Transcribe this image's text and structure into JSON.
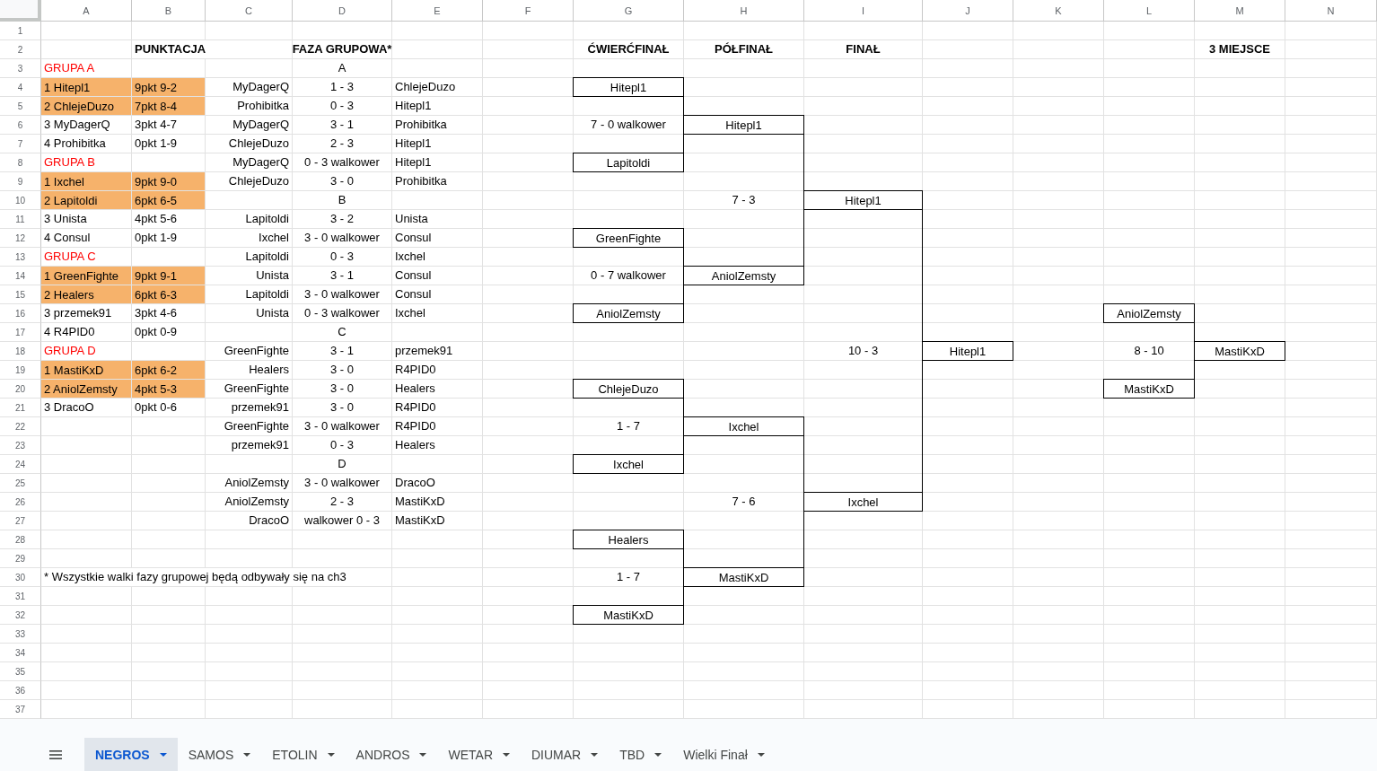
{
  "sheet": {
    "column_headers": [
      "A",
      "B",
      "C",
      "D",
      "E",
      "F",
      "G",
      "H",
      "I",
      "J",
      "K",
      "L",
      "M",
      "N"
    ],
    "rows": [
      {
        "number": "1"
      },
      {
        "number": "2",
        "cells": {
          "b": {
            "kind": "heading",
            "text": "PUNKTACJA"
          },
          "d": {
            "kind": "heading",
            "text": "FAZA GRUPOWA*"
          },
          "g": {
            "kind": "heading",
            "text": "ĆWIERĆFINAŁ"
          },
          "h": {
            "kind": "heading",
            "text": "PÓŁFINAŁ"
          },
          "i": {
            "kind": "heading",
            "text": "FINAŁ"
          },
          "m": {
            "kind": "heading",
            "text": "3 MIEJSCE"
          }
        }
      },
      {
        "number": "3",
        "cells": {
          "a": {
            "kind": "group",
            "text": "GRUPA A"
          },
          "d": {
            "kind": "text",
            "text": "A"
          }
        }
      },
      {
        "number": "4",
        "cells": {
          "a": {
            "kind": "qualified",
            "text": "1 Hitepl1"
          },
          "b": {
            "kind": "qualified",
            "text": "9pkt 9-2"
          },
          "c": {
            "kind": "text",
            "text": "MyDagerQ"
          },
          "d": {
            "kind": "text",
            "text": "1 - 3"
          },
          "e": {
            "kind": "text",
            "text": "ChlejeDuzo"
          },
          "g": {
            "kind": "box",
            "text": "Hitepl1"
          }
        }
      },
      {
        "number": "5",
        "cells": {
          "a": {
            "kind": "qualified",
            "text": "2 ChlejeDuzo"
          },
          "b": {
            "kind": "qualified",
            "text": "7pkt 8-4"
          },
          "c": {
            "kind": "text",
            "text": "Prohibitka"
          },
          "d": {
            "kind": "text",
            "text": "0 - 3"
          },
          "e": {
            "kind": "text",
            "text": "Hitepl1"
          },
          "g": {
            "kind": "line"
          }
        }
      },
      {
        "number": "6",
        "cells": {
          "a": {
            "kind": "text",
            "text": "3 MyDagerQ"
          },
          "b": {
            "kind": "text",
            "text": "3pkt 4-7"
          },
          "c": {
            "kind": "text",
            "text": "MyDagerQ"
          },
          "d": {
            "kind": "text",
            "text": "3 - 1"
          },
          "e": {
            "kind": "text",
            "text": "Prohibitka"
          },
          "g": {
            "kind": "line",
            "text": "7 - 0 walkower"
          },
          "h": {
            "kind": "box",
            "text": "Hitepl1"
          }
        }
      },
      {
        "number": "7",
        "cells": {
          "a": {
            "kind": "text",
            "text": "4 Prohibitka"
          },
          "b": {
            "kind": "text",
            "text": "0pkt 1-9"
          },
          "c": {
            "kind": "text",
            "text": "ChlejeDuzo"
          },
          "d": {
            "kind": "text",
            "text": "2 - 3"
          },
          "e": {
            "kind": "text",
            "text": "Hitepl1"
          },
          "g": {
            "kind": "line"
          },
          "h": {
            "kind": "line"
          }
        }
      },
      {
        "number": "8",
        "cells": {
          "a": {
            "kind": "group",
            "text": "GRUPA B"
          },
          "c": {
            "kind": "text",
            "text": "MyDagerQ"
          },
          "d": {
            "kind": "text",
            "text": "0 - 3 walkower"
          },
          "e": {
            "kind": "text",
            "text": "Hitepl1"
          },
          "g": {
            "kind": "box",
            "text": "Lapitoldi"
          },
          "h": {
            "kind": "line"
          }
        }
      },
      {
        "number": "9",
        "cells": {
          "a": {
            "kind": "qualified",
            "text": "1 Ixchel"
          },
          "b": {
            "kind": "qualified",
            "text": "9pkt 9-0"
          },
          "c": {
            "kind": "text",
            "text": "ChlejeDuzo"
          },
          "d": {
            "kind": "text",
            "text": "3 - 0"
          },
          "e": {
            "kind": "text",
            "text": "Prohibitka"
          },
          "h": {
            "kind": "line"
          }
        }
      },
      {
        "number": "10",
        "cells": {
          "a": {
            "kind": "qualified",
            "text": "2 Lapitoldi"
          },
          "b": {
            "kind": "qualified",
            "text": "6pkt 6-5"
          },
          "d": {
            "kind": "text",
            "text": "B"
          },
          "h": {
            "kind": "line",
            "text": "7 - 3"
          },
          "i": {
            "kind": "box",
            "text": "Hitepl1"
          }
        }
      },
      {
        "number": "11",
        "cells": {
          "a": {
            "kind": "text",
            "text": "3 Unista"
          },
          "b": {
            "kind": "text",
            "text": "4pkt 5-6"
          },
          "c": {
            "kind": "text",
            "text": "Lapitoldi"
          },
          "d": {
            "kind": "text",
            "text": "3 - 2"
          },
          "e": {
            "kind": "text",
            "text": "Unista"
          },
          "h": {
            "kind": "line"
          },
          "i": {
            "kind": "line"
          }
        }
      },
      {
        "number": "12",
        "cells": {
          "a": {
            "kind": "text",
            "text": "4 Consul"
          },
          "b": {
            "kind": "text",
            "text": "0pkt 1-9"
          },
          "c": {
            "kind": "text",
            "text": "Ixchel"
          },
          "d": {
            "kind": "text",
            "text": "3 - 0 walkower"
          },
          "e": {
            "kind": "text",
            "text": "Consul"
          },
          "g": {
            "kind": "box",
            "text": "GreenFighte"
          },
          "h": {
            "kind": "line"
          },
          "i": {
            "kind": "line"
          }
        }
      },
      {
        "number": "13",
        "cells": {
          "a": {
            "kind": "group",
            "text": "GRUPA C"
          },
          "c": {
            "kind": "text",
            "text": "Lapitoldi"
          },
          "d": {
            "kind": "text",
            "text": "0 - 3"
          },
          "e": {
            "kind": "text",
            "text": "Ixchel"
          },
          "g": {
            "kind": "line"
          },
          "h": {
            "kind": "line"
          },
          "i": {
            "kind": "line"
          }
        }
      },
      {
        "number": "14",
        "cells": {
          "a": {
            "kind": "qualified",
            "text": "1 GreenFighte"
          },
          "b": {
            "kind": "qualified",
            "text": "9pkt 9-1"
          },
          "c": {
            "kind": "text",
            "text": "Unista"
          },
          "d": {
            "kind": "text",
            "text": "3 - 1"
          },
          "e": {
            "kind": "text",
            "text": "Consul"
          },
          "g": {
            "kind": "line",
            "text": "0 - 7 walkower"
          },
          "h": {
            "kind": "box",
            "text": "AniolZemsty"
          },
          "i": {
            "kind": "line"
          }
        }
      },
      {
        "number": "15",
        "cells": {
          "a": {
            "kind": "qualified",
            "text": "2 Healers"
          },
          "b": {
            "kind": "qualified",
            "text": "6pkt 6-3"
          },
          "c": {
            "kind": "text",
            "text": "Lapitoldi"
          },
          "d": {
            "kind": "text",
            "text": "3 - 0 walkower"
          },
          "e": {
            "kind": "text",
            "text": "Consul"
          },
          "g": {
            "kind": "line"
          },
          "i": {
            "kind": "line"
          }
        }
      },
      {
        "number": "16",
        "cells": {
          "a": {
            "kind": "text",
            "text": "3 przemek91"
          },
          "b": {
            "kind": "text",
            "text": "3pkt 4-6"
          },
          "c": {
            "kind": "text",
            "text": "Unista"
          },
          "d": {
            "kind": "text",
            "text": "0 - 3 walkower"
          },
          "e": {
            "kind": "text",
            "text": "Ixchel"
          },
          "g": {
            "kind": "box",
            "text": "AniolZemsty"
          },
          "i": {
            "kind": "line"
          },
          "l": {
            "kind": "box",
            "text": "AniolZemsty"
          }
        }
      },
      {
        "number": "17",
        "cells": {
          "a": {
            "kind": "text",
            "text": "4 R4PID0"
          },
          "b": {
            "kind": "text",
            "text": "0pkt 0-9"
          },
          "d": {
            "kind": "text",
            "text": "C"
          },
          "i": {
            "kind": "line"
          },
          "l": {
            "kind": "line"
          }
        }
      },
      {
        "number": "18",
        "cells": {
          "a": {
            "kind": "group",
            "text": "GRUPA D"
          },
          "c": {
            "kind": "text",
            "text": "GreenFighte"
          },
          "d": {
            "kind": "text",
            "text": "3 - 1"
          },
          "e": {
            "kind": "text",
            "text": "przemek91"
          },
          "i": {
            "kind": "line",
            "text": "10 - 3"
          },
          "j": {
            "kind": "box",
            "text": "Hitepl1"
          },
          "l": {
            "kind": "line",
            "text": "8 - 10"
          },
          "m": {
            "kind": "box",
            "text": "MastiKxD"
          }
        }
      },
      {
        "number": "19",
        "cells": {
          "a": {
            "kind": "qualified",
            "text": "1 MastiKxD"
          },
          "b": {
            "kind": "qualified",
            "text": "6pkt 6-2"
          },
          "c": {
            "kind": "text",
            "text": "Healers"
          },
          "d": {
            "kind": "text",
            "text": "3 - 0"
          },
          "e": {
            "kind": "text",
            "text": "R4PID0"
          },
          "i": {
            "kind": "line"
          },
          "l": {
            "kind": "line"
          }
        }
      },
      {
        "number": "20",
        "cells": {
          "a": {
            "kind": "qualified",
            "text": "2 AniolZemsty"
          },
          "b": {
            "kind": "qualified",
            "text": "4pkt 5-3"
          },
          "c": {
            "kind": "text",
            "text": "GreenFighte"
          },
          "d": {
            "kind": "text",
            "text": "3 - 0"
          },
          "e": {
            "kind": "text",
            "text": "Healers"
          },
          "g": {
            "kind": "box",
            "text": "ChlejeDuzo"
          },
          "i": {
            "kind": "line"
          },
          "l": {
            "kind": "box",
            "text": "MastiKxD"
          }
        }
      },
      {
        "number": "21",
        "cells": {
          "a": {
            "kind": "text",
            "text": "3 DracoO"
          },
          "b": {
            "kind": "text",
            "text": "0pkt 0-6"
          },
          "c": {
            "kind": "text",
            "text": "przemek91"
          },
          "d": {
            "kind": "text",
            "text": "3 - 0"
          },
          "e": {
            "kind": "text",
            "text": "R4PID0"
          },
          "g": {
            "kind": "line"
          },
          "i": {
            "kind": "line"
          }
        }
      },
      {
        "number": "22",
        "cells": {
          "c": {
            "kind": "text",
            "text": "GreenFighte"
          },
          "d": {
            "kind": "text",
            "text": "3 - 0 walkower"
          },
          "e": {
            "kind": "text",
            "text": "R4PID0"
          },
          "g": {
            "kind": "line",
            "text": "1 - 7"
          },
          "h": {
            "kind": "box",
            "text": "Ixchel"
          },
          "i": {
            "kind": "line"
          }
        }
      },
      {
        "number": "23",
        "cells": {
          "c": {
            "kind": "text",
            "text": "przemek91"
          },
          "d": {
            "kind": "text",
            "text": "0 - 3"
          },
          "e": {
            "kind": "text",
            "text": "Healers"
          },
          "g": {
            "kind": "line"
          },
          "h": {
            "kind": "line"
          },
          "i": {
            "kind": "line"
          }
        }
      },
      {
        "number": "24",
        "cells": {
          "d": {
            "kind": "text",
            "text": "D"
          },
          "g": {
            "kind": "box",
            "text": "Ixchel"
          },
          "h": {
            "kind": "line"
          },
          "i": {
            "kind": "line"
          }
        }
      },
      {
        "number": "25",
        "cells": {
          "c": {
            "kind": "text",
            "text": "AniolZemsty"
          },
          "d": {
            "kind": "text",
            "text": "3 - 0 walkower"
          },
          "e": {
            "kind": "text",
            "text": "DracoO"
          },
          "h": {
            "kind": "line"
          },
          "i": {
            "kind": "line"
          }
        }
      },
      {
        "number": "26",
        "cells": {
          "c": {
            "kind": "text",
            "text": "AniolZemsty"
          },
          "d": {
            "kind": "text",
            "text": "2 - 3"
          },
          "e": {
            "kind": "text",
            "text": "MastiKxD"
          },
          "h": {
            "kind": "line",
            "text": "7 - 6"
          },
          "i": {
            "kind": "box",
            "text": "Ixchel"
          }
        }
      },
      {
        "number": "27",
        "cells": {
          "c": {
            "kind": "text",
            "text": "DracoO"
          },
          "d": {
            "kind": "text",
            "text": "walkower 0 - 3"
          },
          "e": {
            "kind": "text",
            "text": "MastiKxD"
          },
          "h": {
            "kind": "line"
          }
        }
      },
      {
        "number": "28",
        "cells": {
          "g": {
            "kind": "box",
            "text": "Healers"
          },
          "h": {
            "kind": "line"
          }
        }
      },
      {
        "number": "29",
        "cells": {
          "g": {
            "kind": "line"
          },
          "h": {
            "kind": "line"
          }
        }
      },
      {
        "number": "30",
        "cells": {
          "a": {
            "kind": "text",
            "text": "* Wszystkie walki fazy grupowej będą odbywały się na ch3"
          },
          "g": {
            "kind": "line",
            "text": "1 - 7"
          },
          "h": {
            "kind": "box",
            "text": "MastiKxD"
          }
        }
      },
      {
        "number": "31",
        "cells": {
          "g": {
            "kind": "line"
          }
        }
      },
      {
        "number": "32",
        "cells": {
          "g": {
            "kind": "box",
            "text": "MastiKxD"
          }
        }
      },
      {
        "number": "33"
      },
      {
        "number": "34"
      },
      {
        "number": "35"
      },
      {
        "number": "36"
      },
      {
        "number": "37"
      }
    ]
  },
  "sheet_tabs": [
    {
      "label": "NEGROS",
      "selected": true
    },
    {
      "label": "SAMOS",
      "selected": false
    },
    {
      "label": "ETOLIN",
      "selected": false
    },
    {
      "label": "ANDROS",
      "selected": false
    },
    {
      "label": "WETAR",
      "selected": false
    },
    {
      "label": "DIUMAR",
      "selected": false
    },
    {
      "label": "TBD",
      "selected": false
    },
    {
      "label": "Wielki Finał",
      "selected": false
    }
  ]
}
